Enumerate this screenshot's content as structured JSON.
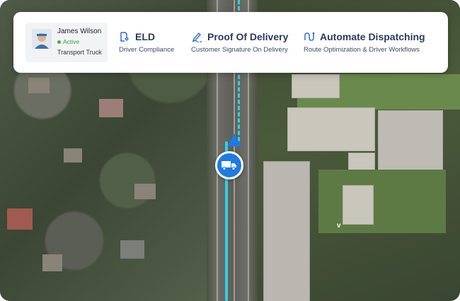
{
  "driver": {
    "name": "James Wilson",
    "status": "Active",
    "vehicle": "Transport Truck"
  },
  "features": [
    {
      "title": "ELD",
      "subtitle": "Driver Compliance",
      "icon": "eld-icon"
    },
    {
      "title": "Proof Of Delivery",
      "subtitle": "Customer Signature On Delivery",
      "icon": "signature-pen-icon"
    },
    {
      "title": "Automate Dispatching",
      "subtitle": "Route Optimization & Driver Workflows",
      "icon": "route-icon"
    }
  ],
  "map": {
    "label": "v",
    "route_color": "#2fd1e6",
    "marker_color": "#1e7be3",
    "marker_icon": "truck-icon"
  },
  "colors": {
    "feature_title": "#2b3a60",
    "status_active": "#3ab54a"
  }
}
